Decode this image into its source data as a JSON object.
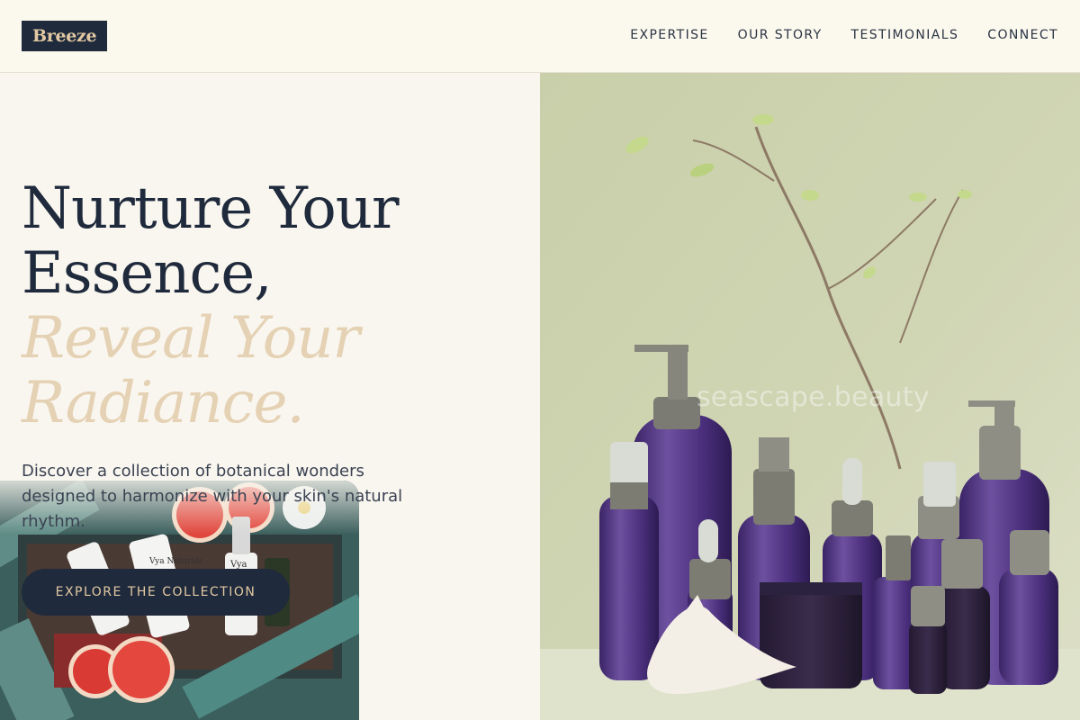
{
  "brand": {
    "logo_text": "Breeze"
  },
  "nav": {
    "items": [
      {
        "label": "EXPERTISE"
      },
      {
        "label": "OUR STORY"
      },
      {
        "label": "TESTIMONIALS"
      },
      {
        "label": "CONNECT"
      }
    ]
  },
  "hero": {
    "title_line1": "Nurture Your",
    "title_line2": "Essence,",
    "accent_line1": "Reveal Your",
    "accent_line2": "Radiance.",
    "subtitle": "Discover a collection of botanical wonders designed to harmonize with your skin's natural rhythm.",
    "cta_label": "EXPLORE THE COLLECTION"
  },
  "photo": {
    "watermark": "seascape.beauty",
    "background_color": "#cdd3b0",
    "bottle_color": "#5a3f8a"
  },
  "tile": {
    "bottle_labels": [
      "Vya Naturals",
      "Vya"
    ]
  },
  "colors": {
    "navy": "#1f2a3c",
    "accent_gold": "#e3c9a3",
    "page_background": "#f9f6ef"
  }
}
